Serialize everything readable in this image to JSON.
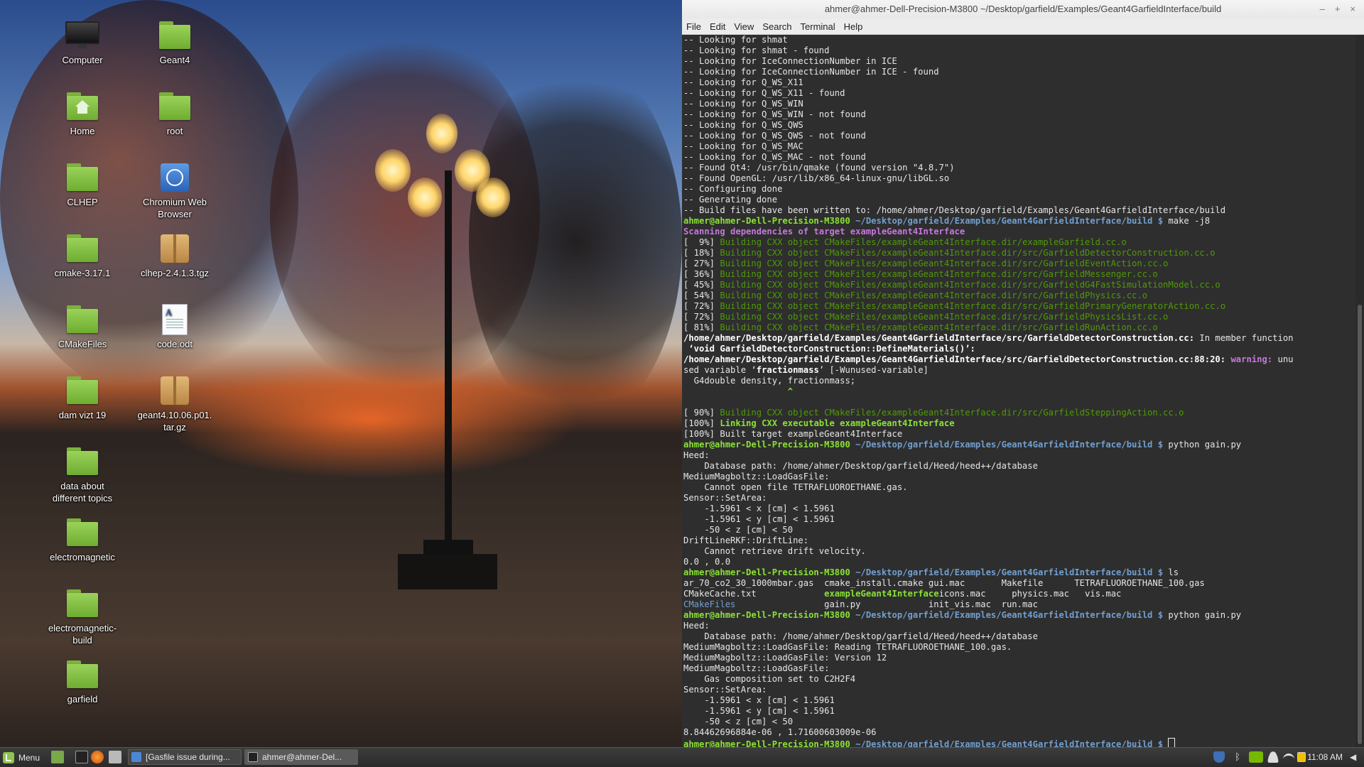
{
  "desktop": {
    "icons": [
      {
        "label": "Computer",
        "type": "computer"
      },
      {
        "label": "Geant4",
        "type": "folder"
      },
      {
        "label": "Home",
        "type": "home"
      },
      {
        "label": "root",
        "type": "folder"
      },
      {
        "label": "CLHEP",
        "type": "folder"
      },
      {
        "label": "Chromium Web\nBrowser",
        "type": "chromium"
      },
      {
        "label": "cmake-3.17.1",
        "type": "folder"
      },
      {
        "label": "clhep-2.4.1.3.tgz",
        "type": "archive"
      },
      {
        "label": "CMakeFiles",
        "type": "folder"
      },
      {
        "label": "code.odt",
        "type": "document"
      },
      {
        "label": "dam vizt 19",
        "type": "folder"
      },
      {
        "label": "geant4.10.06.p01.\ntar.gz",
        "type": "archive"
      },
      {
        "label": "data about\ndifferent topics",
        "type": "folder"
      },
      {
        "label": "electromagnetic",
        "type": "folder"
      },
      {
        "label": "electromagnetic-\nbuild",
        "type": "folder"
      },
      {
        "label": "garfield",
        "type": "folder"
      }
    ]
  },
  "terminal": {
    "title": "ahmer@ahmer-Dell-Precision-M3800 ~/Desktop/garfield/Examples/Geant4GarfieldInterface/build",
    "window_controls": [
      "–",
      "+",
      "×"
    ],
    "menu": [
      "File",
      "Edit",
      "View",
      "Search",
      "Terminal",
      "Help"
    ],
    "prompt_user": "ahmer@ahmer-Dell-Precision-M3800",
    "prompt_path": "~/Desktop/garfield/Examples/Geant4GarfieldInterface/build $",
    "lines": [
      {
        "k": "t",
        "t": "-- Looking for shmat"
      },
      {
        "k": "t",
        "t": "-- Looking for shmat - found"
      },
      {
        "k": "t",
        "t": "-- Looking for IceConnectionNumber in ICE"
      },
      {
        "k": "t",
        "t": "-- Looking for IceConnectionNumber in ICE - found"
      },
      {
        "k": "t",
        "t": "-- Looking for Q_WS_X11"
      },
      {
        "k": "t",
        "t": "-- Looking for Q_WS_X11 - found"
      },
      {
        "k": "t",
        "t": "-- Looking for Q_WS_WIN"
      },
      {
        "k": "t",
        "t": "-- Looking for Q_WS_WIN - not found"
      },
      {
        "k": "t",
        "t": "-- Looking for Q_WS_QWS"
      },
      {
        "k": "t",
        "t": "-- Looking for Q_WS_QWS - not found"
      },
      {
        "k": "t",
        "t": "-- Looking for Q_WS_MAC"
      },
      {
        "k": "t",
        "t": "-- Looking for Q_WS_MAC - not found"
      },
      {
        "k": "t",
        "t": "-- Found Qt4: /usr/bin/qmake (found version \"4.8.7\")"
      },
      {
        "k": "t",
        "t": "-- Found OpenGL: /usr/lib/x86_64-linux-gnu/libGL.so"
      },
      {
        "k": "t",
        "t": "-- Configuring done"
      },
      {
        "k": "t",
        "t": "-- Generating done"
      },
      {
        "k": "t",
        "t": "-- Build files have been written to: /home/ahmer/Desktop/garfield/Examples/Geant4GarfieldInterface/build"
      },
      {
        "k": "p",
        "t": " make -j8"
      },
      {
        "k": "m",
        "t": "Scanning dependencies of target exampleGeant4Interface"
      },
      {
        "k": "b",
        "pct": "[  9%] ",
        "t": "Building CXX object CMakeFiles/exampleGeant4Interface.dir/exampleGarfield.cc.o"
      },
      {
        "k": "b",
        "pct": "[ 18%] ",
        "t": "Building CXX object CMakeFiles/exampleGeant4Interface.dir/src/GarfieldDetectorConstruction.cc.o"
      },
      {
        "k": "b",
        "pct": "[ 27%] ",
        "t": "Building CXX object CMakeFiles/exampleGeant4Interface.dir/src/GarfieldEventAction.cc.o"
      },
      {
        "k": "b",
        "pct": "[ 36%] ",
        "t": "Building CXX object CMakeFiles/exampleGeant4Interface.dir/src/GarfieldMessenger.cc.o"
      },
      {
        "k": "b",
        "pct": "[ 45%] ",
        "t": "Building CXX object CMakeFiles/exampleGeant4Interface.dir/src/GarfieldG4FastSimulationModel.cc.o"
      },
      {
        "k": "b",
        "pct": "[ 54%] ",
        "t": "Building CXX object CMakeFiles/exampleGeant4Interface.dir/src/GarfieldPhysics.cc.o"
      },
      {
        "k": "b",
        "pct": "[ 72%] ",
        "t": "Building CXX object CMakeFiles/exampleGeant4Interface.dir/src/GarfieldPrimaryGeneratorAction.cc.o"
      },
      {
        "k": "b",
        "pct": "[ 72%] ",
        "t": "Building CXX object CMakeFiles/exampleGeant4Interface.dir/src/GarfieldPhysicsList.cc.o"
      },
      {
        "k": "b",
        "pct": "[ 81%] ",
        "t": "Building CXX object CMakeFiles/exampleGeant4Interface.dir/src/GarfieldRunAction.cc.o"
      },
      {
        "k": "w1",
        "t": "/home/ahmer/Desktop/garfield/Examples/Geant4GarfieldInterface/src/GarfieldDetectorConstruction.cc:",
        "t2": " In member function"
      },
      {
        "k": "w2",
        "t": " ‘void GarfieldDetectorConstruction::DefineMaterials()’:"
      },
      {
        "k": "w3",
        "t": "/home/ahmer/Desktop/garfield/Examples/Geant4GarfieldInterface/src/GarfieldDetectorConstruction.cc:88:20:",
        "w": " warning:",
        "t2": " unu"
      },
      {
        "k": "w4",
        "t": "sed variable ‘",
        "bold": "fractionmass",
        "t2": "’ [-Wunused-variable]"
      },
      {
        "k": "t",
        "t": "  G4double density, fractionmass;"
      },
      {
        "k": "caret",
        "t": "                    ^"
      },
      {
        "k": "t",
        "t": ""
      },
      {
        "k": "b",
        "pct": "[ 90%] ",
        "t": "Building CXX object CMakeFiles/exampleGeant4Interface.dir/src/GarfieldSteppingAction.cc.o"
      },
      {
        "k": "l",
        "pct": "[100%] ",
        "t": "Linking CXX executable exampleGeant4Interface"
      },
      {
        "k": "t",
        "t": "[100%] Built target exampleGeant4Interface"
      },
      {
        "k": "p",
        "t": " python gain.py"
      },
      {
        "k": "t",
        "t": "Heed:"
      },
      {
        "k": "t",
        "t": "    Database path: /home/ahmer/Desktop/garfield/Heed/heed++/database"
      },
      {
        "k": "t",
        "t": "MediumMagboltz::LoadGasFile:"
      },
      {
        "k": "t",
        "t": "    Cannot open file TETRAFLUOROETHANE.gas."
      },
      {
        "k": "t",
        "t": "Sensor::SetArea:"
      },
      {
        "k": "t",
        "t": "    -1.5961 < x [cm] < 1.5961"
      },
      {
        "k": "t",
        "t": "    -1.5961 < y [cm] < 1.5961"
      },
      {
        "k": "t",
        "t": "    -50 < z [cm] < 50"
      },
      {
        "k": "t",
        "t": "DriftLineRKF::DriftLine:"
      },
      {
        "k": "t",
        "t": "    Cannot retrieve drift velocity."
      },
      {
        "k": "t",
        "t": "0.0 , 0.0"
      },
      {
        "k": "p",
        "t": " ls"
      },
      {
        "k": "ls",
        "cols": [
          {
            "t": "ar_70_co2_30_1000mbar.gas",
            "c": ""
          },
          {
            "t": "cmake_install.cmake",
            "c": ""
          },
          {
            "t": "gui.mac",
            "c": ""
          },
          {
            "t": "Makefile",
            "c": ""
          },
          {
            "t": "TETRAFLUOROETHANE_100.gas",
            "c": ""
          }
        ]
      },
      {
        "k": "ls",
        "cols": [
          {
            "t": "CMakeCache.txt",
            "c": ""
          },
          {
            "t": "exampleGeant4Interface",
            "c": "exe"
          },
          {
            "t": "icons.mac",
            "c": ""
          },
          {
            "t": "physics.mac",
            "c": ""
          },
          {
            "t": "vis.mac",
            "c": ""
          }
        ]
      },
      {
        "k": "ls",
        "cols": [
          {
            "t": "CMakeFiles",
            "c": "dir"
          },
          {
            "t": "gain.py",
            "c": ""
          },
          {
            "t": "init_vis.mac",
            "c": ""
          },
          {
            "t": "run.mac",
            "c": ""
          },
          {
            "t": "",
            "c": ""
          }
        ]
      },
      {
        "k": "p",
        "t": " python gain.py"
      },
      {
        "k": "t",
        "t": "Heed:"
      },
      {
        "k": "t",
        "t": "    Database path: /home/ahmer/Desktop/garfield/Heed/heed++/database"
      },
      {
        "k": "t",
        "t": "MediumMagboltz::LoadGasFile: Reading TETRAFLUOROETHANE_100.gas."
      },
      {
        "k": "t",
        "t": "MediumMagboltz::LoadGasFile: Version 12"
      },
      {
        "k": "t",
        "t": "MediumMagboltz::LoadGasFile:"
      },
      {
        "k": "t",
        "t": "    Gas composition set to C2H2F4"
      },
      {
        "k": "t",
        "t": "Sensor::SetArea:"
      },
      {
        "k": "t",
        "t": "    -1.5961 < x [cm] < 1.5961"
      },
      {
        "k": "t",
        "t": "    -1.5961 < y [cm] < 1.5961"
      },
      {
        "k": "t",
        "t": "    -50 < z [cm] < 50"
      },
      {
        "k": "t",
        "t": "8.84462696884e-06 , 1.71600603009e-06"
      },
      {
        "k": "pc",
        "t": " "
      }
    ]
  },
  "taskbar": {
    "menu_label": "Menu",
    "quick_launch": [
      "show-desktop-icon",
      "terminal-icon",
      "firefox-icon",
      "files-icon"
    ],
    "tasks": [
      {
        "label": "[Gasfile issue during...",
        "icon": "chromium-icon"
      },
      {
        "label": "ahmer@ahmer-Del...",
        "icon": "terminal-icon"
      }
    ],
    "tray": [
      "shield-icon",
      "bluetooth-icon",
      "nvidia-icon",
      "user-icon",
      "wifi-icon",
      "battery-icon"
    ],
    "clock": "11:08 AM",
    "volume": "volume-icon"
  },
  "colors": {
    "prompt_green": "#8ae234",
    "path_blue": "#729fcf",
    "magenta": "#c678dd",
    "build_green": "#4e9a06",
    "terminal_bg": "#2e2e2e"
  }
}
